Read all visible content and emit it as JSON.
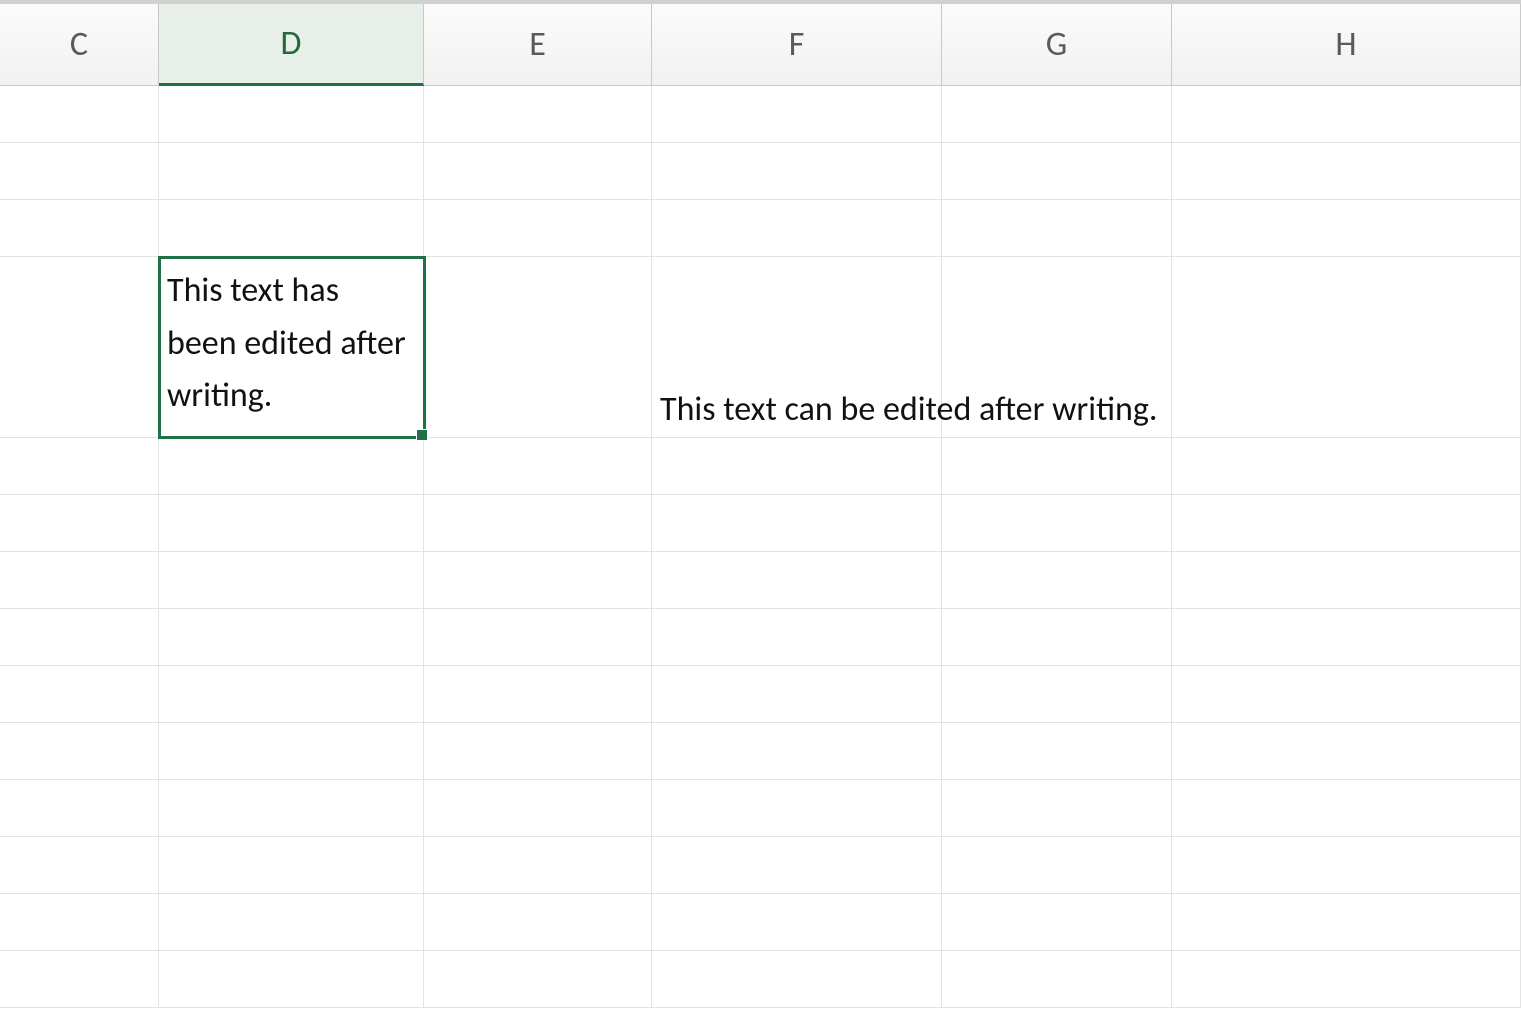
{
  "columns": {
    "c": "C",
    "d": "D",
    "e": "E",
    "f": "F",
    "g": "G",
    "h": "H"
  },
  "selected_column": "D",
  "cells": {
    "d4": "This text has been edited after writing.",
    "f4": "This text can be edited after writing."
  },
  "selection": {
    "cell": "D4"
  }
}
